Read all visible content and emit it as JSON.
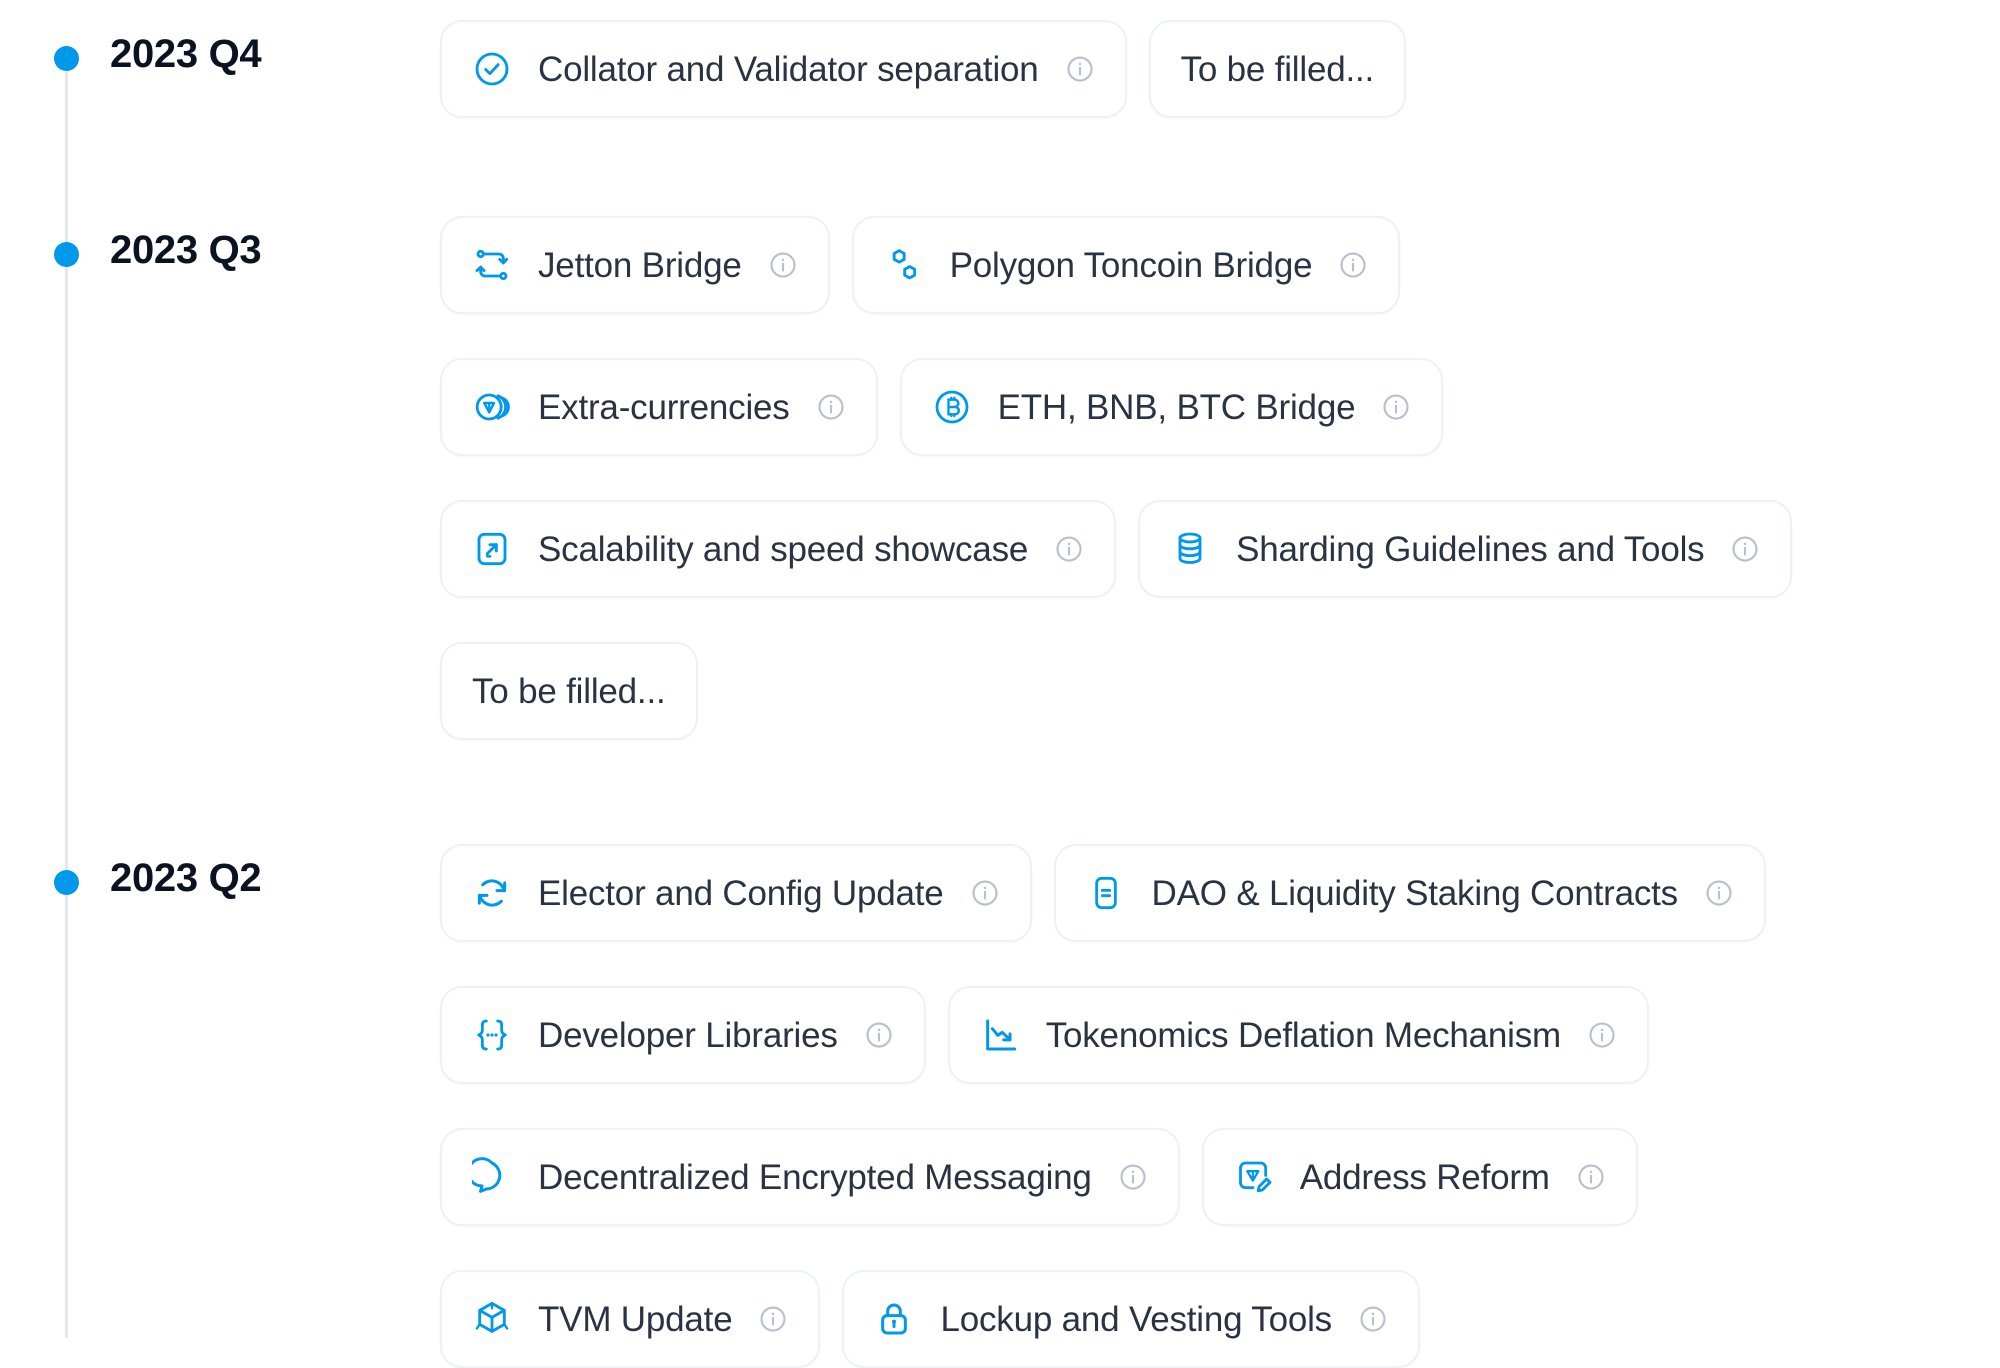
{
  "timeline": {
    "accent_color": "#0098ea",
    "rail_color": "#e2e8f0",
    "quarters": [
      {
        "id": "2023q4",
        "label": "2023 Q4",
        "rows": [
          [
            {
              "icon": "check-circle-icon",
              "label": "Collator and Validator separation",
              "info": true
            },
            {
              "icon": "none",
              "label": "To be filled...",
              "info": false
            }
          ]
        ]
      },
      {
        "id": "2023q3",
        "label": "2023 Q3",
        "rows": [
          [
            {
              "icon": "bridge-nodes-icon",
              "label": "Jetton Bridge",
              "info": true
            },
            {
              "icon": "polygon-hexagons-icon",
              "label": "Polygon Toncoin Bridge",
              "info": true
            }
          ],
          [
            {
              "icon": "coins-ton-icon",
              "label": "Extra-currencies",
              "info": true
            },
            {
              "icon": "bitcoin-circle-icon",
              "label": "ETH, BNB, BTC Bridge",
              "info": true
            }
          ],
          [
            {
              "icon": "expand-arrow-box-icon",
              "label": "Scalability and speed showcase",
              "info": true
            },
            {
              "icon": "database-stack-icon",
              "label": "Sharding Guidelines and Tools",
              "info": true
            }
          ],
          [
            {
              "icon": "none",
              "label": "To be filled...",
              "info": false
            }
          ]
        ]
      },
      {
        "id": "2023q2",
        "label": "2023 Q2",
        "rows": [
          [
            {
              "icon": "refresh-circle-icon",
              "label": "Elector and Config Update",
              "info": true
            },
            {
              "icon": "document-lines-icon",
              "label": "DAO & Liquidity Staking Contracts",
              "info": true
            }
          ],
          [
            {
              "icon": "curly-braces-icon",
              "label": "Developer Libraries",
              "info": true
            },
            {
              "icon": "chart-down-icon",
              "label": "Tokenomics Deflation Mechanism",
              "info": true
            }
          ],
          [
            {
              "icon": "chat-bubble-icon",
              "label": "Decentralized Encrypted Messaging",
              "info": true
            },
            {
              "icon": "address-edit-icon",
              "label": "Address Reform",
              "info": true
            }
          ],
          [
            {
              "icon": "cube-3d-icon",
              "label": "TVM Update",
              "info": true
            },
            {
              "icon": "lock-icon",
              "label": "Lockup and Vesting Tools",
              "info": true
            }
          ]
        ]
      }
    ]
  }
}
